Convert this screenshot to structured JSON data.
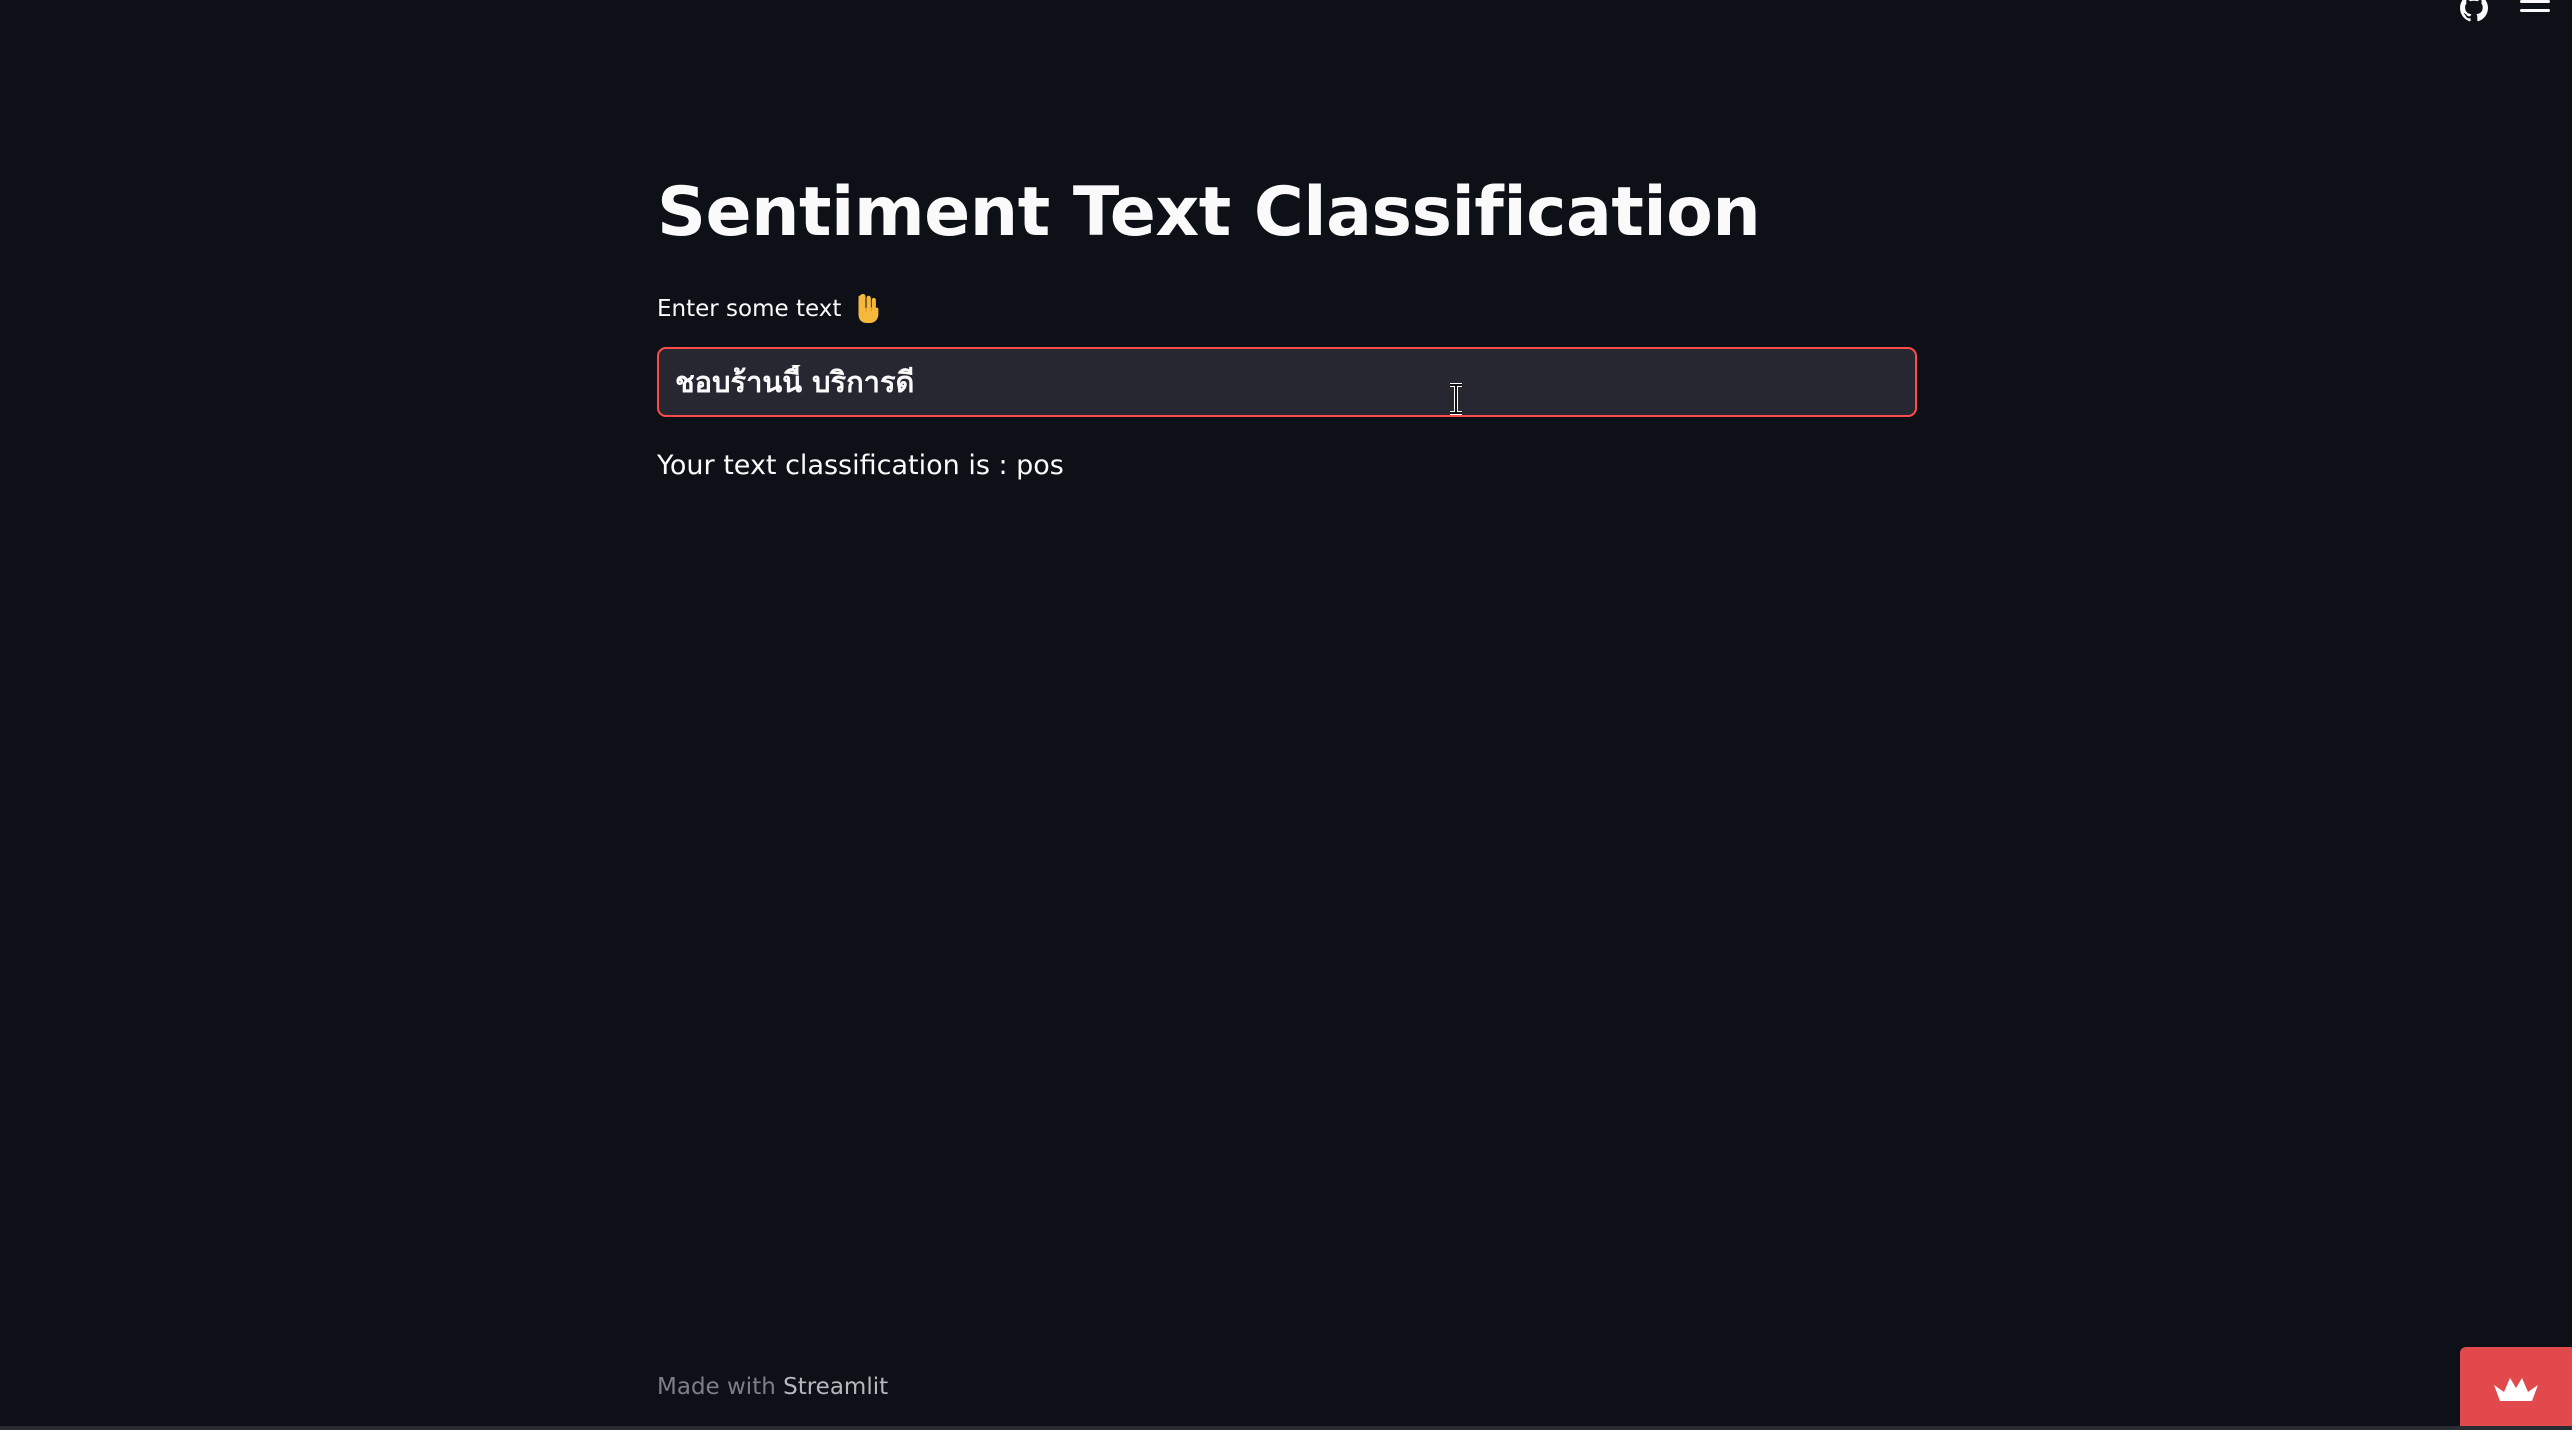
{
  "header": {
    "github_icon": "github-icon",
    "menu_icon": "hamburger-menu-icon"
  },
  "main": {
    "title": "Sentiment Text Classification",
    "input_label": "Enter some text",
    "input_label_emoji": "pointing-down-hand-icon",
    "input_value": "ชอบร้านนี้ บริการดี",
    "result_text": "Your text classification is : pos"
  },
  "footer": {
    "made_with": "Made with",
    "brand": "Streamlit"
  },
  "deploy_badge": {
    "icon": "crown-icon"
  },
  "colors": {
    "background": "#0e1017",
    "input_background": "#262730",
    "input_focus_border": "#ff4b4b",
    "badge": "#e2494d",
    "text": "#fafafa",
    "muted": "#7d7f86"
  }
}
